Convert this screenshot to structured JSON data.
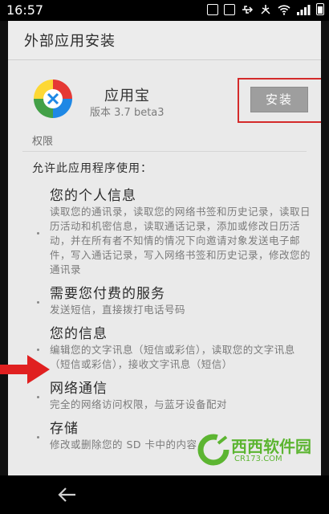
{
  "status_bar": {
    "time": "16:57"
  },
  "header": {
    "title": "外部应用安装"
  },
  "app": {
    "name": "应用宝",
    "version": "版本 3.7 beta3"
  },
  "install_button": {
    "label": "安装"
  },
  "permissions_section": {
    "label": "权限",
    "intro": "允许此应用程序使用：",
    "items": [
      {
        "title": "您的个人信息",
        "desc": "读取您的通讯录，读取您的网络书签和历史记录，读取日历活动和机密信息，读取通话记录，添加或修改日历活动，并在所有者不知情的情况下向邀请对象发送电子邮件，写入通话记录，写入网络书签和历史记录，修改您的通讯录"
      },
      {
        "title": "需要您付费的服务",
        "desc": "发送短信，直接拨打电话号码"
      },
      {
        "title": "您的信息",
        "desc": "编辑您的文字讯息（短信或彩信），读取您的文字讯息（短信或彩信），接收文字讯息（短信）"
      },
      {
        "title": "网络通信",
        "desc": "完全的网络访问权限，与蓝牙设备配对"
      },
      {
        "title": "存储",
        "desc": "修改或删除您的 SD 卡中的内容"
      }
    ]
  },
  "watermark": {
    "brand": "西西软件园",
    "url": "CR173.COM"
  },
  "colors": {
    "highlight_frame": "#d42a2a",
    "arrow": "#e02020",
    "watermark_green": "#5cb531"
  },
  "icons": [
    "app-logo-icon",
    "back-arrow-icon",
    "wifi-icon",
    "signal-icon",
    "battery-icon",
    "usb-icon"
  ]
}
